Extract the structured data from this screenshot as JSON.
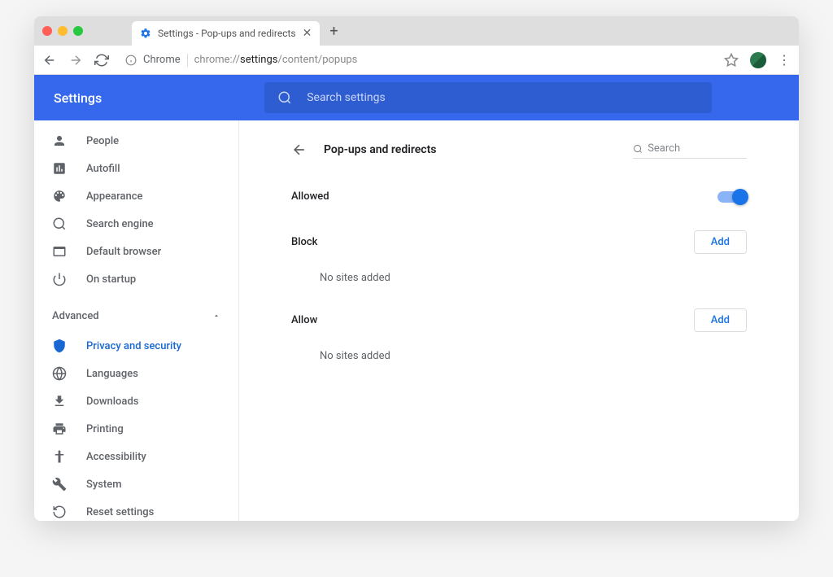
{
  "tab": {
    "title": "Settings - Pop-ups and redirects"
  },
  "address": {
    "chrome_label": "Chrome",
    "url_pre": "chrome://",
    "url_bold": "settings",
    "url_post": "/content/popups"
  },
  "app": {
    "title": "Settings",
    "search_placeholder": "Search settings"
  },
  "sidebar": {
    "items": [
      {
        "label": "People"
      },
      {
        "label": "Autofill"
      },
      {
        "label": "Appearance"
      },
      {
        "label": "Search engine"
      },
      {
        "label": "Default browser"
      },
      {
        "label": "On startup"
      }
    ],
    "advanced_label": "Advanced",
    "advanced_items": [
      {
        "label": "Privacy and security"
      },
      {
        "label": "Languages"
      },
      {
        "label": "Downloads"
      },
      {
        "label": "Printing"
      },
      {
        "label": "Accessibility"
      },
      {
        "label": "System"
      },
      {
        "label": "Reset settings"
      }
    ]
  },
  "content": {
    "title": "Pop-ups and redirects",
    "search_placeholder": "Search",
    "allowed_label": "Allowed",
    "block": {
      "title": "Block",
      "add_label": "Add",
      "empty": "No sites added"
    },
    "allow": {
      "title": "Allow",
      "add_label": "Add",
      "empty": "No sites added"
    }
  }
}
